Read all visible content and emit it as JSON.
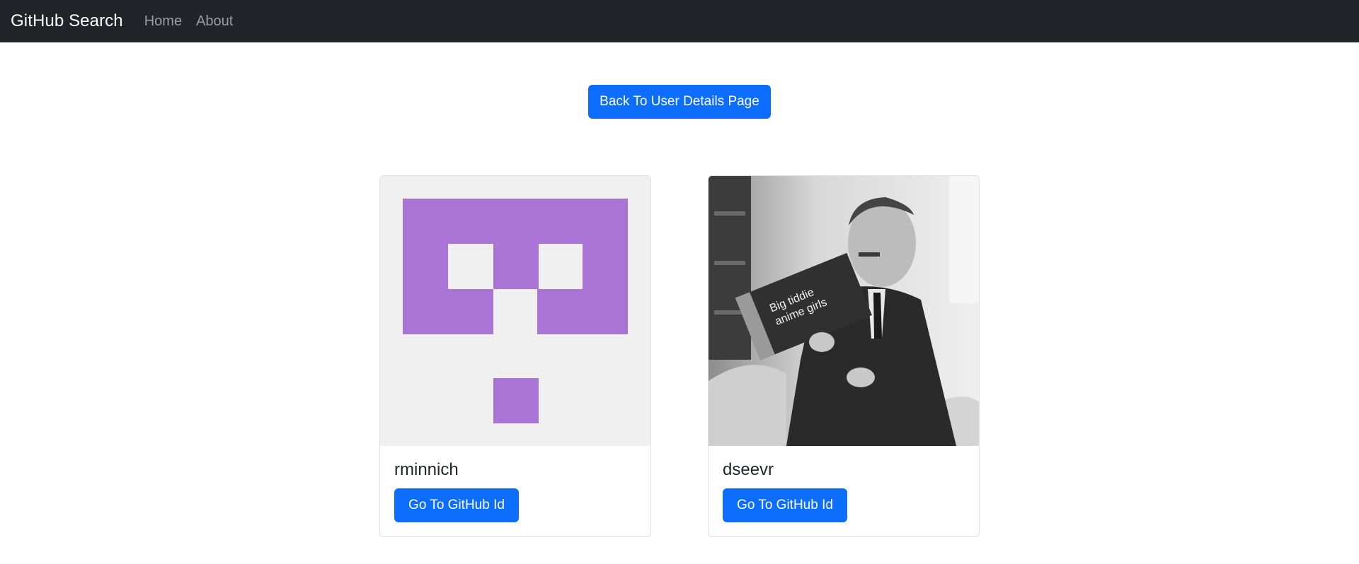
{
  "navbar": {
    "brand": "GitHub Search",
    "links": [
      "Home",
      "About"
    ]
  },
  "back_button": "Back To User Details Page",
  "users": [
    {
      "login": "rminnich",
      "button_label": "Go To GitHub Id",
      "avatar": "identicon-purple"
    },
    {
      "login": "dseevr",
      "button_label": "Go To GitHub Id",
      "avatar": "photo-man-reading-book",
      "book_title": "Big tiddie anime girls"
    }
  ],
  "colors": {
    "navbar_bg": "#212529",
    "primary": "#0d6efd",
    "identicon": "#a974d6",
    "identicon_bg": "#f0f0f0"
  }
}
